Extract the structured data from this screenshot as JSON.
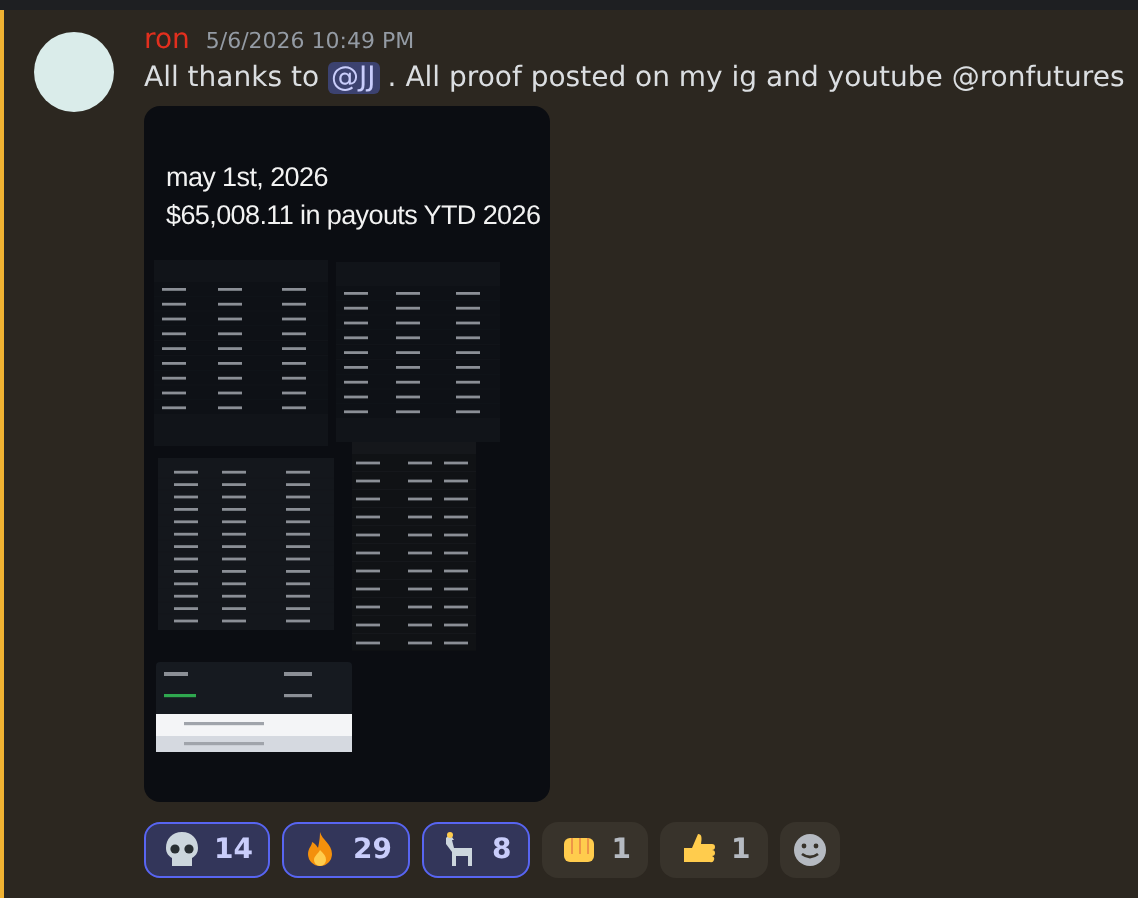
{
  "message": {
    "author": "ron",
    "timestamp": "5/6/2026 10:49 PM",
    "text_before": "All thanks to",
    "mention": "@JJ",
    "text_after": ". All proof posted on my ig and youtube @ronfutures",
    "attachment": {
      "lines": [
        "may 1st, 2026",
        "$65,008.11 in payouts YTD 2026"
      ]
    }
  },
  "reactions": [
    {
      "count": "14",
      "selected": true
    },
    {
      "count": "29",
      "selected": true
    },
    {
      "count": "8",
      "selected": true
    },
    {
      "count": "1",
      "selected": false
    },
    {
      "count": "1",
      "selected": false
    }
  ]
}
